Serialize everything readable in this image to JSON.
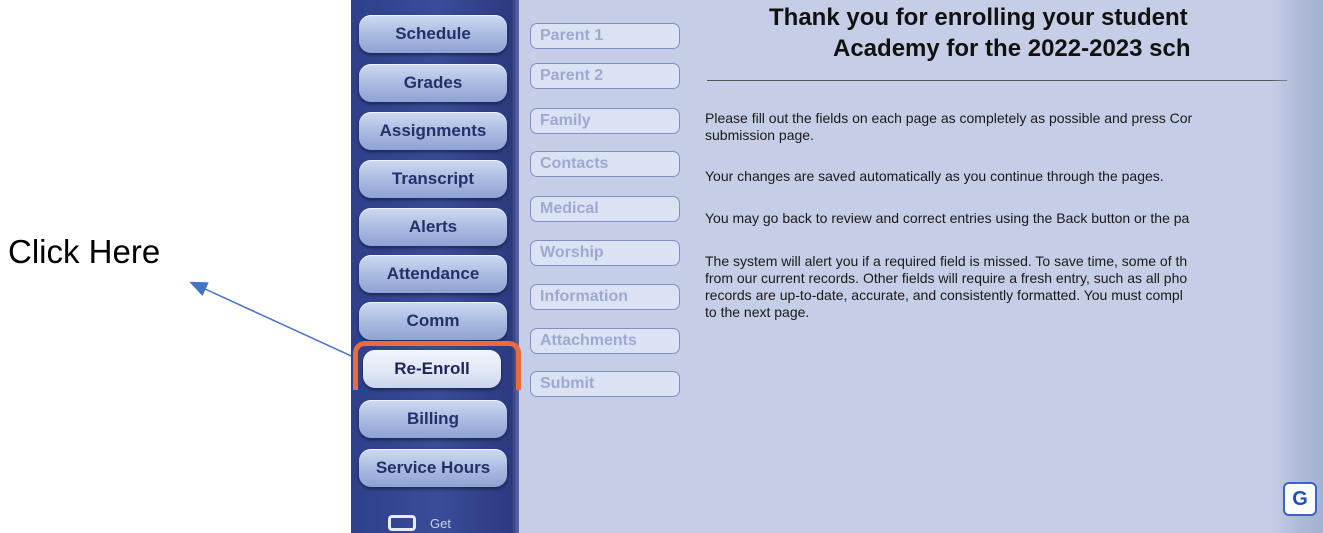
{
  "annotation": {
    "callout_text": "Click Here",
    "arrow_color": "#4472c4",
    "highlight_color": "#ec6b3a"
  },
  "sidebar": {
    "items": [
      {
        "label": "Schedule"
      },
      {
        "label": "Grades"
      },
      {
        "label": "Assignments"
      },
      {
        "label": "Transcript"
      },
      {
        "label": "Alerts"
      },
      {
        "label": "Attendance"
      },
      {
        "label": "Comm"
      },
      {
        "label": "Re-Enroll",
        "active": true
      },
      {
        "label": "Billing"
      },
      {
        "label": "Service Hours"
      }
    ],
    "get_app_label": "Get"
  },
  "steps": {
    "items": [
      {
        "label": "Parent 1"
      },
      {
        "label": "Parent 2"
      },
      {
        "label": "Family"
      },
      {
        "label": "Contacts"
      },
      {
        "label": "Medical"
      },
      {
        "label": "Worship"
      },
      {
        "label": "Information"
      },
      {
        "label": "Attachments"
      },
      {
        "label": "Submit"
      }
    ]
  },
  "content": {
    "title_line1": "Thank you for enrolling your student",
    "title_line2": "Academy for the 2022-2023 sch",
    "paragraphs": [
      {
        "lines": [
          "Please fill out the fields on each page as completely as possible and press Cor",
          "submission page."
        ]
      },
      {
        "lines": [
          "Your changes are saved automatically as you continue through the pages."
        ]
      },
      {
        "lines": [
          "You may go back to review and correct entries using the Back button or the pa"
        ]
      },
      {
        "lines": [
          "The system will alert you if a required field is missed. To save time, some of th",
          "from our current records. Other fields will require a fresh entry, such as all pho",
          "records are up-to-date, accurate, and consistently formatted. You must compl",
          "to the next page."
        ]
      }
    ]
  },
  "corner_logo": {
    "letter": "G",
    "color": "#1f4fb8"
  }
}
